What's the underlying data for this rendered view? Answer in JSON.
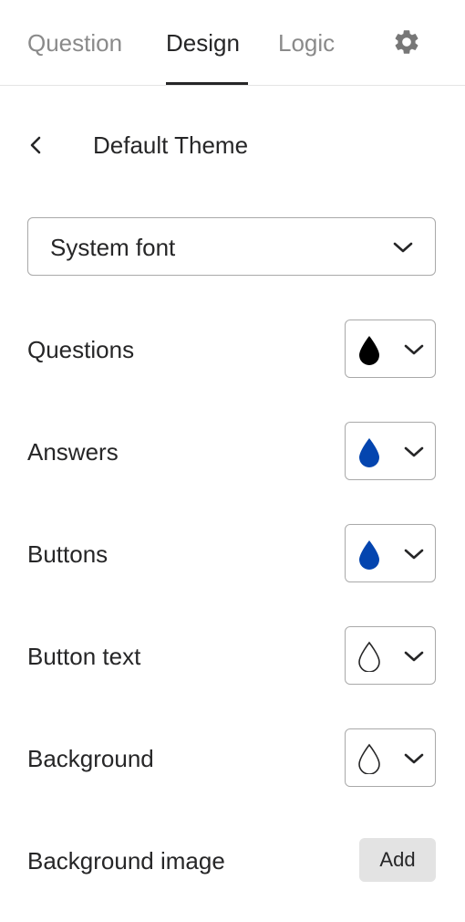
{
  "tabs": [
    {
      "label": "Question",
      "active": false
    },
    {
      "label": "Design",
      "active": true
    },
    {
      "label": "Logic",
      "active": false
    }
  ],
  "icons": {
    "settings": "gear-icon",
    "back": "chevron-left-icon",
    "dropdown": "chevron-down-icon",
    "color": "droplet-icon"
  },
  "theme": {
    "title": "Default Theme"
  },
  "font": {
    "selected": "System font"
  },
  "colors": [
    {
      "label": "Questions",
      "color": "#000000",
      "filled": true
    },
    {
      "label": "Answers",
      "color": "#0445AF",
      "filled": true
    },
    {
      "label": "Buttons",
      "color": "#0445AF",
      "filled": true
    },
    {
      "label": "Button text",
      "color": "#FFFFFF",
      "filled": false
    },
    {
      "label": "Background",
      "color": "#FFFFFF",
      "filled": false
    }
  ],
  "background_image": {
    "label": "Background image",
    "button": "Add"
  }
}
